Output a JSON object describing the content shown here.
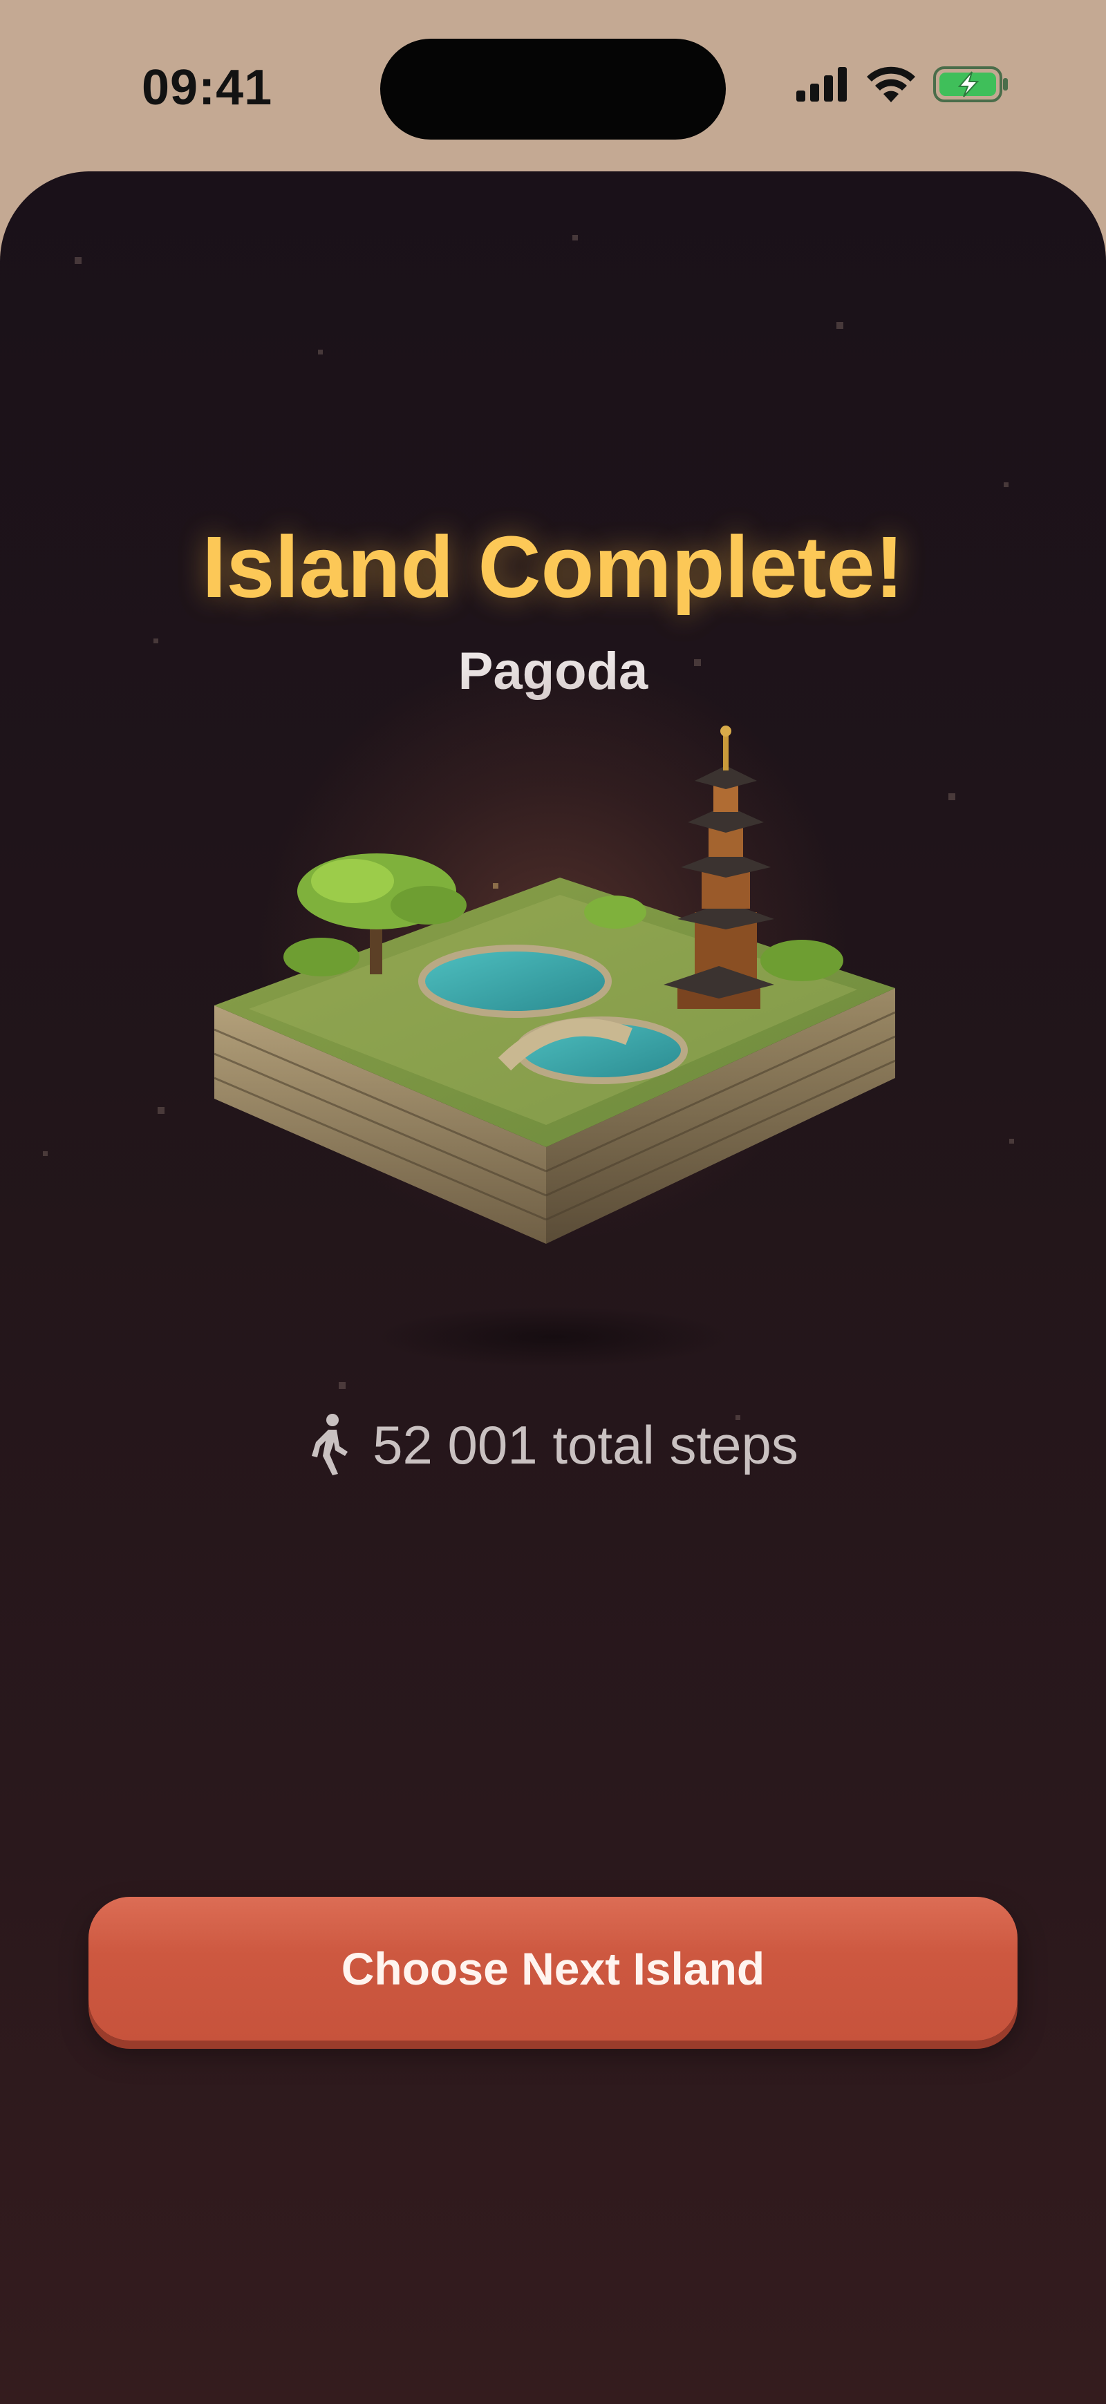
{
  "status_bar": {
    "time": "09:41",
    "icons": [
      "cellular-signal-icon",
      "wifi-icon",
      "battery-charging-icon"
    ],
    "background_color": "#c4a993"
  },
  "completion": {
    "title": "Island Complete!",
    "island_name": "Pagoda",
    "title_color": "#fcc857"
  },
  "island_image": {
    "icon": "pagoda-island-illustration"
  },
  "stats": {
    "icon": "walking-person-icon",
    "steps_text": "52 001 total steps"
  },
  "actions": {
    "next_island_label": "Choose Next Island",
    "button_color": "#cd5840"
  }
}
